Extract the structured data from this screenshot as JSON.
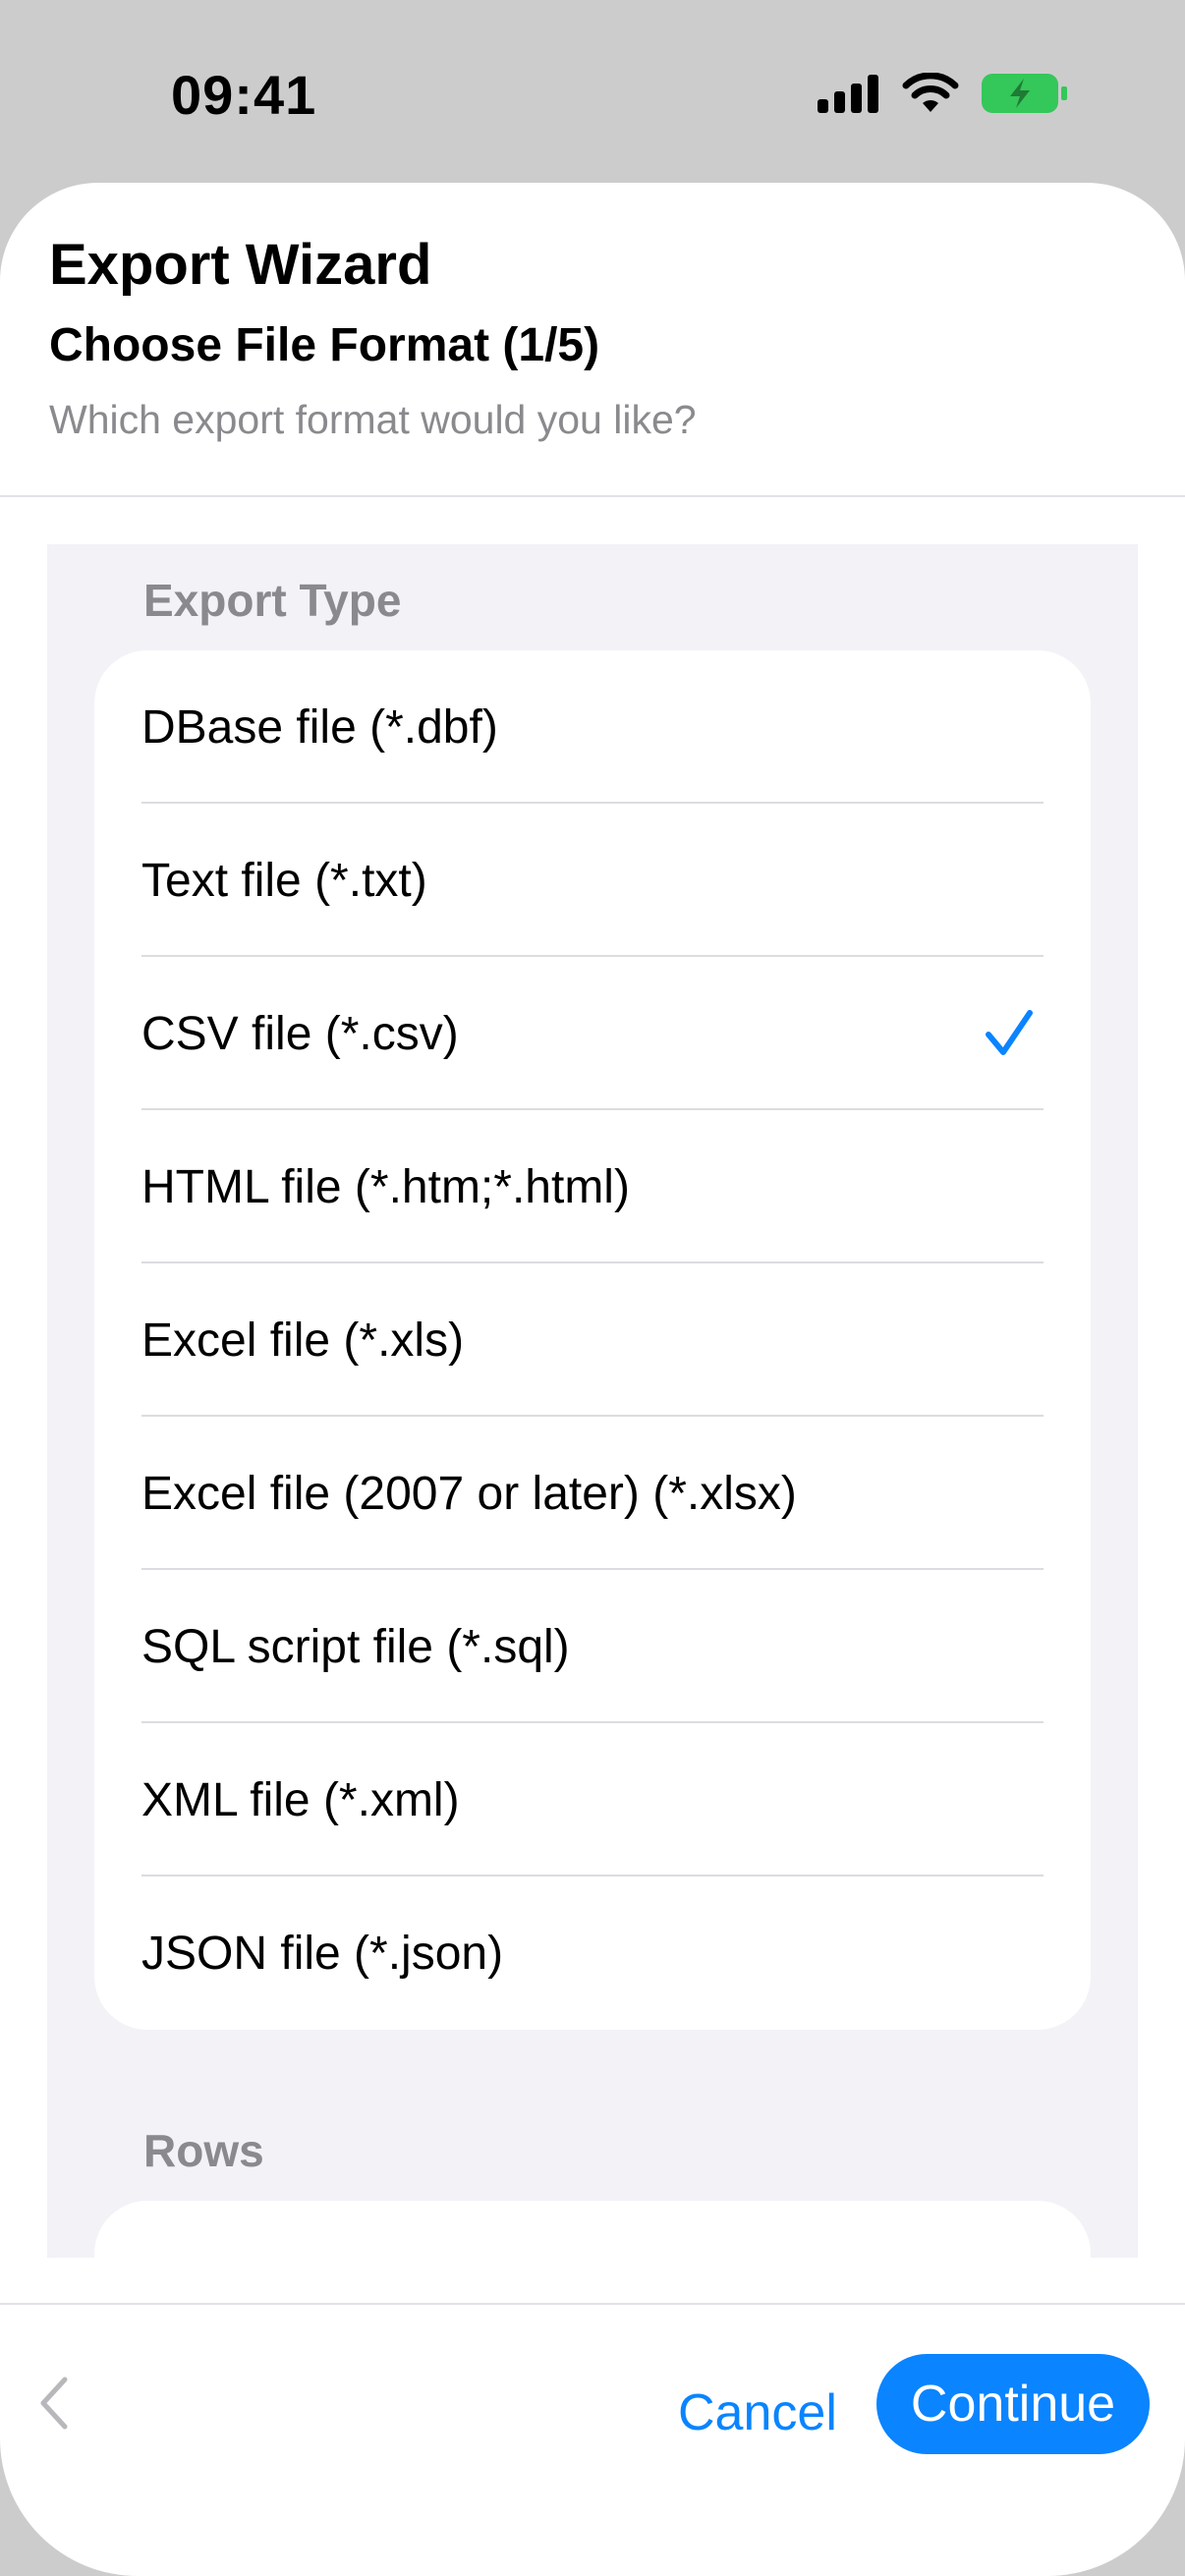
{
  "status_bar": {
    "time": "09:41",
    "icons": [
      "signal-icon",
      "wifi-icon",
      "battery-charging-icon"
    ],
    "battery_color": "#34c759"
  },
  "wizard": {
    "title": "Export Wizard",
    "step_title": "Choose File Format (1/5)",
    "step_subtitle": "Which export format would you like?"
  },
  "export_type": {
    "section_title": "Export Type",
    "options": [
      {
        "label": "DBase file (*.dbf)",
        "selected": false
      },
      {
        "label": "Text file (*.txt)",
        "selected": false
      },
      {
        "label": "CSV file (*.csv)",
        "selected": true
      },
      {
        "label": "HTML file (*.htm;*.html)",
        "selected": false
      },
      {
        "label": "Excel file (*.xls)",
        "selected": false
      },
      {
        "label": "Excel file (2007 or later) (*.xlsx)",
        "selected": false
      },
      {
        "label": "SQL script file (*.sql)",
        "selected": false
      },
      {
        "label": "XML file (*.xml)",
        "selected": false
      },
      {
        "label": "JSON file (*.json)",
        "selected": false
      }
    ]
  },
  "rows": {
    "section_title": "Rows"
  },
  "footer": {
    "back_icon": "chevron-left-icon",
    "cancel_label": "Cancel",
    "continue_label": "Continue"
  },
  "colors": {
    "accent": "#0a84ff",
    "secondary_text": "#8a8a8e",
    "grouped_background": "#f2f2f7"
  }
}
